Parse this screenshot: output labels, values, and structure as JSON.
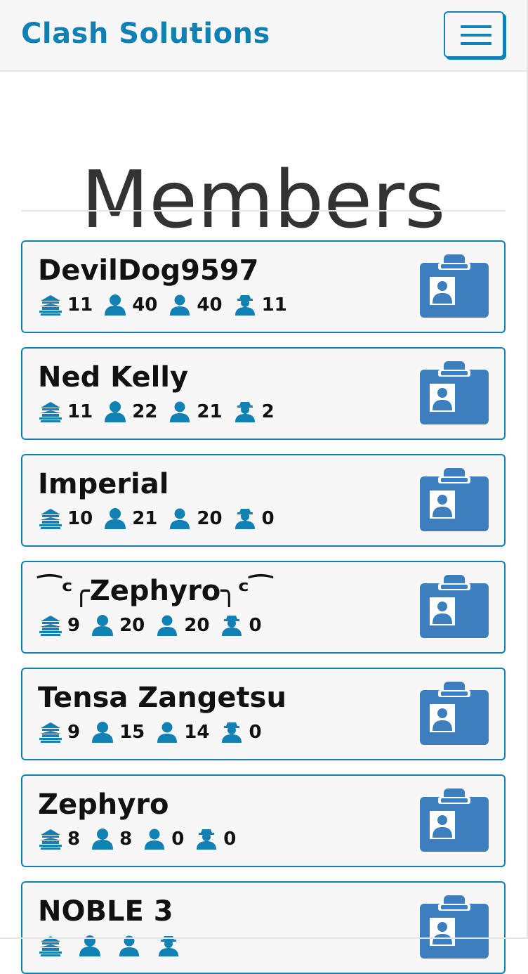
{
  "navbar": {
    "brand": "Clash Solutions",
    "toggle_icon": "hamburger-menu-icon"
  },
  "page": {
    "title": "Members"
  },
  "colors": {
    "brand": "#1181b4",
    "profile_button": "#3d7ebf",
    "card_background": "#f7f7f7"
  },
  "stat_icons": [
    "town-hall-icon",
    "donations-icon",
    "received-icon",
    "war-stars-icon"
  ],
  "profile_icon": "id-card-icon",
  "members": [
    {
      "name": "DevilDog9597",
      "stats": [
        "11",
        "40",
        "40",
        "11"
      ]
    },
    {
      "name": "Ned Kelly",
      "stats": [
        "11",
        "22",
        "21",
        "2"
      ]
    },
    {
      "name": "Imperial",
      "stats": [
        "10",
        "21",
        "20",
        "0"
      ]
    },
    {
      "name": "⁀ᶜ╭Zephyro╮ᶜ⁀",
      "stats": [
        "9",
        "20",
        "20",
        "0"
      ]
    },
    {
      "name": "Tensa Zangetsu",
      "stats": [
        "9",
        "15",
        "14",
        "0"
      ]
    },
    {
      "name": "Zephyro",
      "stats": [
        "8",
        "8",
        "0",
        "0"
      ]
    },
    {
      "name": "NOBLE 3",
      "stats": [
        "",
        "",
        "",
        ""
      ]
    }
  ]
}
